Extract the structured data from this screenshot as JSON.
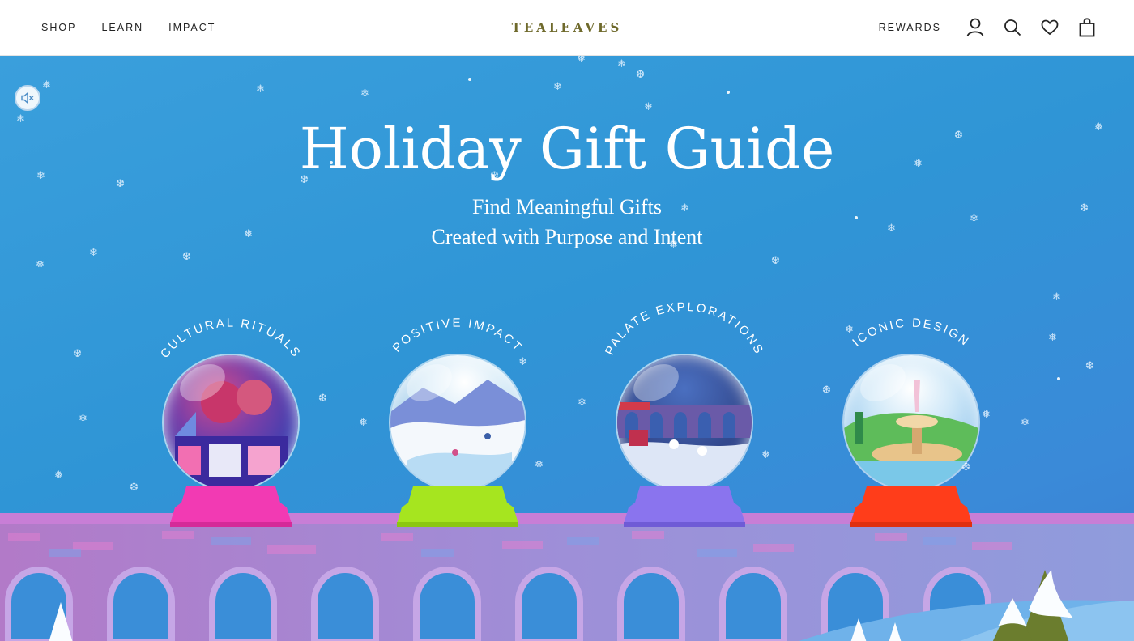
{
  "header": {
    "nav": [
      "SHOP",
      "LEARN",
      "IMPACT"
    ],
    "brand": "TEALEAVES",
    "rewards": "REWARDS",
    "icons": [
      "account-icon",
      "search-icon",
      "wishlist-heart-icon",
      "cart-bag-icon"
    ]
  },
  "hero": {
    "title": "Holiday Gift Guide",
    "subtitle_line1": "Find Meaningful Gifts",
    "subtitle_line2": "Created with Purpose and Intent",
    "mute_icon": "speaker-muted-icon",
    "globes": [
      {
        "label": "CULTURAL RITUALS",
        "base_color": "#f23ab3"
      },
      {
        "label": "POSITIVE IMPACT",
        "base_color": "#a6e51f"
      },
      {
        "label": "PALATE EXPLORATIONS",
        "base_color": "#8a74ee"
      },
      {
        "label": "ICONIC DESIGN",
        "base_color": "#ff3d1a"
      }
    ]
  },
  "colors": {
    "brand": "#6f6a2c",
    "sky": "#2f95d6",
    "bridge": "#9b8fd6"
  }
}
